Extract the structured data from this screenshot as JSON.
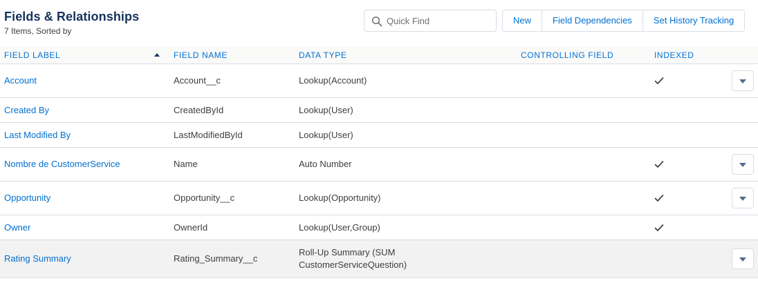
{
  "header": {
    "title": "Fields & Relationships",
    "subtitle": "7 Items, Sorted by"
  },
  "search": {
    "placeholder": "Quick Find",
    "icon": "search-icon"
  },
  "actions": {
    "new_label": "New",
    "field_dependencies_label": "Field Dependencies",
    "set_history_tracking_label": "Set History Tracking"
  },
  "table": {
    "columns": {
      "field_label": "FIELD LABEL",
      "field_name": "FIELD NAME",
      "data_type": "DATA TYPE",
      "controlling_field": "CONTROLLING FIELD",
      "indexed": "INDEXED"
    },
    "sort_column": "FIELD LABEL",
    "sort_direction": "ascending",
    "rows": [
      {
        "label": "Account",
        "name": "Account__c",
        "type": "Lookup(Account)",
        "controlling": "",
        "indexed": true,
        "has_menu": true
      },
      {
        "label": "Created By",
        "name": "CreatedById",
        "type": "Lookup(User)",
        "controlling": "",
        "indexed": false,
        "has_menu": false
      },
      {
        "label": "Last Modified By",
        "name": "LastModifiedById",
        "type": "Lookup(User)",
        "controlling": "",
        "indexed": false,
        "has_menu": false
      },
      {
        "label": "Nombre de CustomerService",
        "name": "Name",
        "type": "Auto Number",
        "controlling": "",
        "indexed": true,
        "has_menu": true
      },
      {
        "label": "Opportunity",
        "name": "Opportunity__c",
        "type": "Lookup(Opportunity)",
        "controlling": "",
        "indexed": true,
        "has_menu": true
      },
      {
        "label": "Owner",
        "name": "OwnerId",
        "type": "Lookup(User,Group)",
        "controlling": "",
        "indexed": true,
        "has_menu": false
      },
      {
        "label": "Rating Summary",
        "name": "Rating_Summary__c",
        "type": "Roll-Up Summary (SUM CustomerServiceQuestion)",
        "controlling": "",
        "indexed": false,
        "has_menu": true,
        "highlighted": true
      }
    ]
  },
  "colors": {
    "link": "#0070d2",
    "title": "#16325c",
    "text": "#3e3e3c",
    "border": "#d8dde6",
    "header_bg": "#fafaf9",
    "hover_row_bg": "#f3f2f2"
  }
}
